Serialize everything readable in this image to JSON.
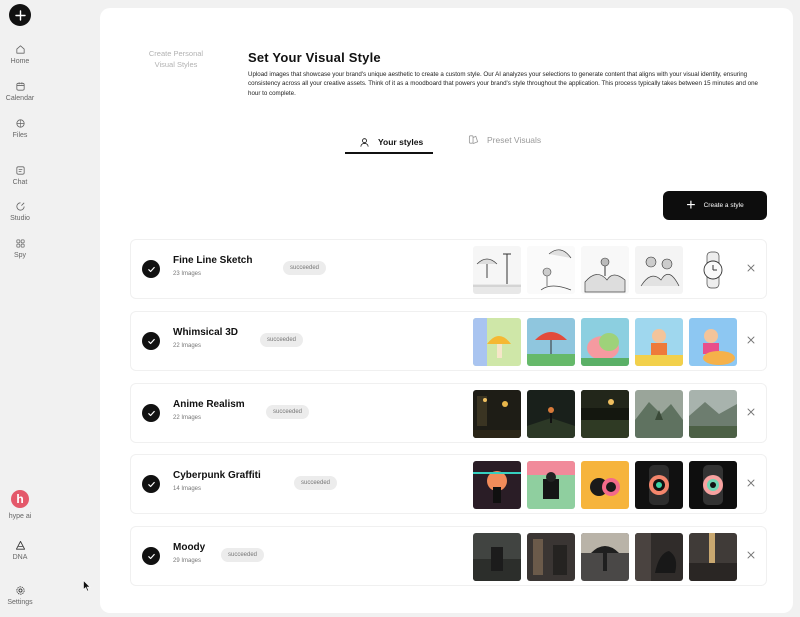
{
  "sidebar": {
    "new_button_icon": "plus-icon",
    "items": [
      {
        "label": "Home",
        "icon": "home-icon"
      },
      {
        "label": "Calendar",
        "icon": "calendar-icon"
      },
      {
        "label": "Files",
        "icon": "files-icon"
      },
      {
        "label": "Chat",
        "icon": "chat-icon"
      },
      {
        "label": "Studio",
        "icon": "studio-icon"
      },
      {
        "label": "Spy",
        "icon": "spy-icon"
      }
    ],
    "workspace": {
      "initial": "h",
      "label": "hype ai",
      "color": "#e4586a"
    },
    "dna_label": "DNA",
    "settings_label": "Settings"
  },
  "breadcrumb": {
    "line1": "Create Personal",
    "line2": "Visual Styles"
  },
  "header": {
    "title": "Set Your Visual Style",
    "description": "Upload images that showcase your brand's unique aesthetic to create a custom style. Our AI analyzes your selections to generate content that aligns with your visual identity, ensuring consistency across all your creative assets. Think of it as a moodboard that powers your brand's style throughout the application. This process typically takes between 15 minutes and one hour to complete."
  },
  "tabs": [
    {
      "label": "Your styles",
      "active": true,
      "icon": "user-icon"
    },
    {
      "label": "Preset Visuals",
      "active": false,
      "icon": "palette-icon"
    }
  ],
  "create_button": {
    "label": "Create a style"
  },
  "styles": [
    {
      "name": "Fine Line Sketch",
      "count": "23 Images",
      "status": "succeeded",
      "theme": "sketch"
    },
    {
      "name": "Whimsical 3D",
      "count": "22 Images",
      "status": "succeeded",
      "theme": "whimsical"
    },
    {
      "name": "Anime Realism",
      "count": "22 Images",
      "status": "succeeded",
      "theme": "anime"
    },
    {
      "name": "Cyberpunk Graffiti",
      "count": "14 Images",
      "status": "succeeded",
      "theme": "cyberpunk"
    },
    {
      "name": "Moody",
      "count": "29 Images",
      "status": "succeeded",
      "theme": "moody"
    }
  ],
  "colors": {
    "accent": "#111111",
    "badge_bg": "#ececec",
    "page_bg": "#f1f1f1"
  }
}
